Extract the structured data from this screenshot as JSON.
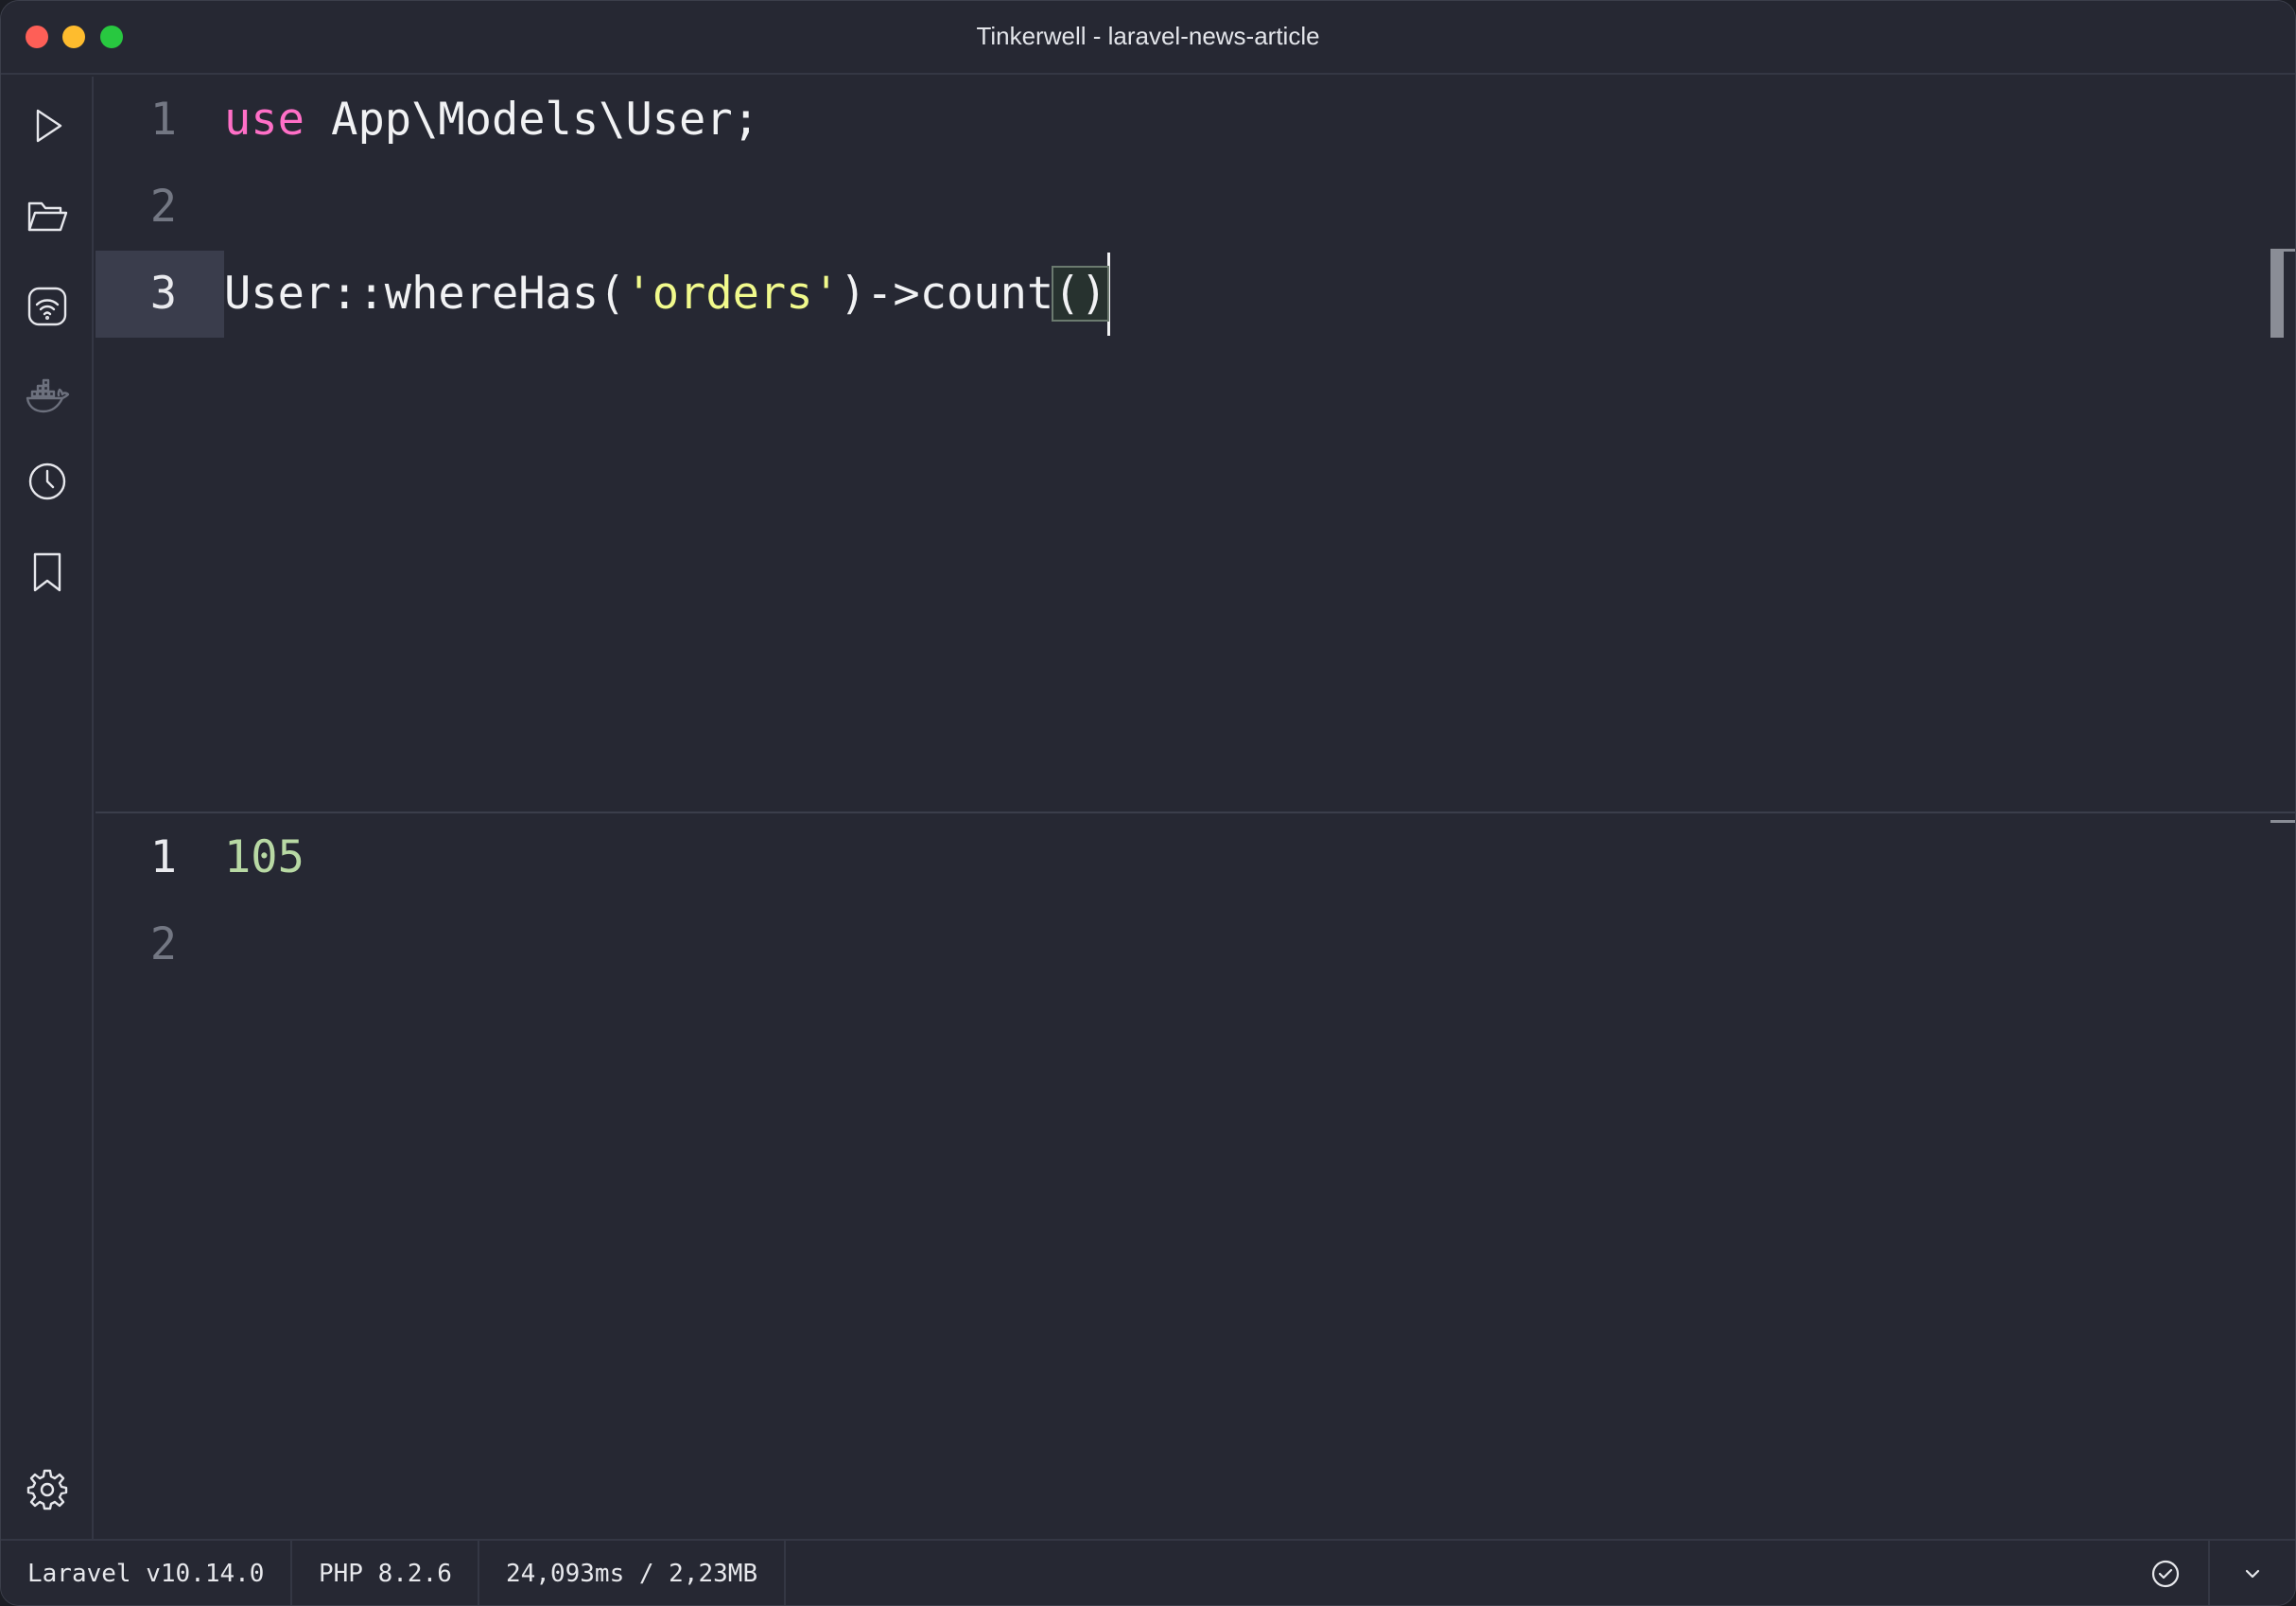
{
  "window": {
    "title": "Tinkerwell - laravel-news-article"
  },
  "sidebar": {
    "items": [
      {
        "name": "run",
        "icon": "play-icon"
      },
      {
        "name": "open",
        "icon": "folder-open-icon"
      },
      {
        "name": "connection",
        "icon": "wifi-icon"
      },
      {
        "name": "docker",
        "icon": "docker-icon"
      },
      {
        "name": "history",
        "icon": "clock-icon"
      },
      {
        "name": "snippets",
        "icon": "bookmark-icon"
      }
    ],
    "settings_icon": "gear-icon"
  },
  "editor": {
    "lines": [
      {
        "number": "1",
        "keyword": "use",
        "rest": " App\\Models\\User;"
      },
      {
        "number": "2"
      },
      {
        "number": "3",
        "before_string": "User::whereHas(",
        "string": "'orders'",
        "after_string": ")->count",
        "paren_open": "(",
        "paren_close": ")"
      }
    ],
    "active_line": "3"
  },
  "output": {
    "lines": [
      {
        "number": "1",
        "value": "105"
      },
      {
        "number": "2"
      }
    ]
  },
  "statusbar": {
    "framework": "Laravel v10.14.0",
    "php": "PHP 8.2.6",
    "metrics": "24,093ms / 2,23MB",
    "check_icon": "check-circle-icon",
    "menu_icon": "chevron-down-icon"
  },
  "colors": {
    "background": "#262833",
    "keyword": "#ff6fc7",
    "string": "#f1fa8c",
    "result": "#b8d9a4"
  }
}
